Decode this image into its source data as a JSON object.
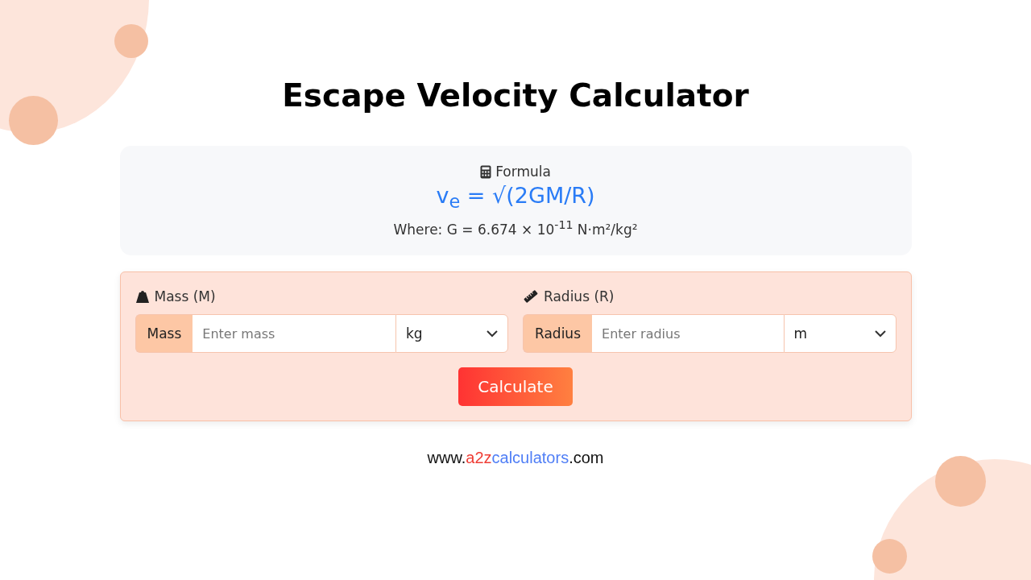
{
  "title": "Escape Velocity Calculator",
  "formula": {
    "heading": "Formula",
    "expression": "v$_{e}$ = √(2GM/R)",
    "note": "Where: G = 6.674 × 10$^{-11}$ N·m²/kg²"
  },
  "fields": [
    {
      "kind": "weight",
      "label": "Mass (M)",
      "prefix": "Mass",
      "placeholder": "Enter mass",
      "unit": "kg"
    },
    {
      "kind": "ruler",
      "label": "Radius (R)",
      "prefix": "Radius",
      "placeholder": "Enter radius",
      "unit": "m"
    }
  ],
  "button": "Calculate",
  "footer": [
    {
      "kind": "plain",
      "text": "www."
    },
    {
      "kind": "red",
      "text": "a2z"
    },
    {
      "kind": "blue",
      "text": "calculators"
    },
    {
      "kind": "plain",
      "text": ".com"
    }
  ]
}
